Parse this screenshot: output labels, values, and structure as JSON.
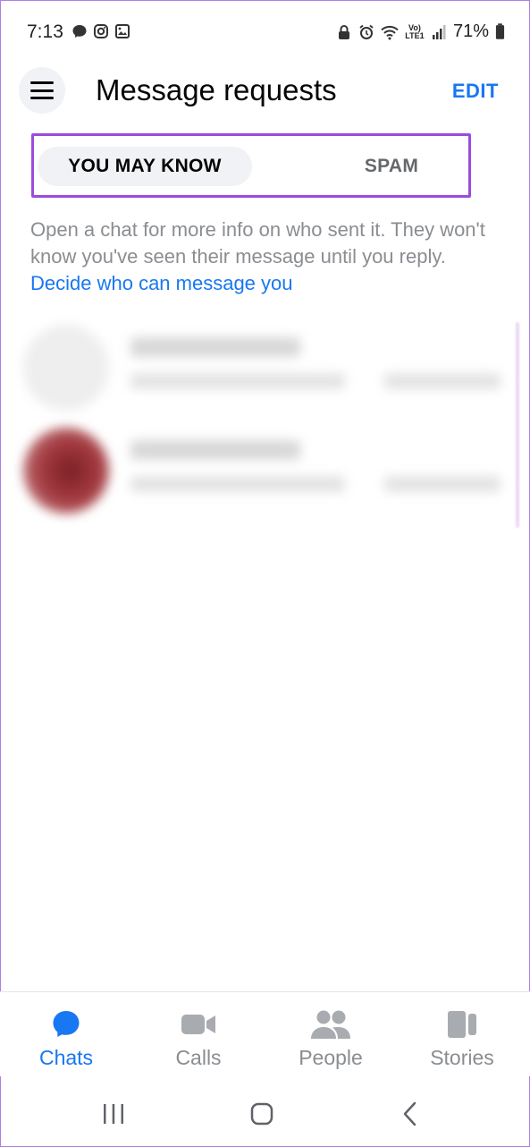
{
  "status_bar": {
    "time": "7:13",
    "battery": "71%",
    "left_icons": [
      "message-bubble-icon",
      "instagram-icon",
      "gallery-icon"
    ],
    "right_icons": [
      "lock-icon",
      "alarm-icon",
      "wifi-icon",
      "volte-icon",
      "signal-icon",
      "battery-icon"
    ],
    "network_label": "Vo) LTE1"
  },
  "header": {
    "title": "Message requests",
    "edit_label": "EDIT"
  },
  "tabs": {
    "active_label": "YOU MAY KNOW",
    "spam_label": "SPAM"
  },
  "info": {
    "text": "Open a chat for more info on who sent it. They won't know you've seen their message until you reply. ",
    "link_text": "Decide who can message you"
  },
  "bottom_nav": {
    "items": [
      {
        "label": "Chats",
        "icon": "chat-bubble-icon",
        "active": true
      },
      {
        "label": "Calls",
        "icon": "video-camera-icon",
        "active": false
      },
      {
        "label": "People",
        "icon": "people-icon",
        "active": false
      },
      {
        "label": "Stories",
        "icon": "stories-icon",
        "active": false
      }
    ]
  },
  "colors": {
    "accent": "#1877f2",
    "highlight_border": "#9b4bdc",
    "muted_text": "#8a8d91"
  }
}
